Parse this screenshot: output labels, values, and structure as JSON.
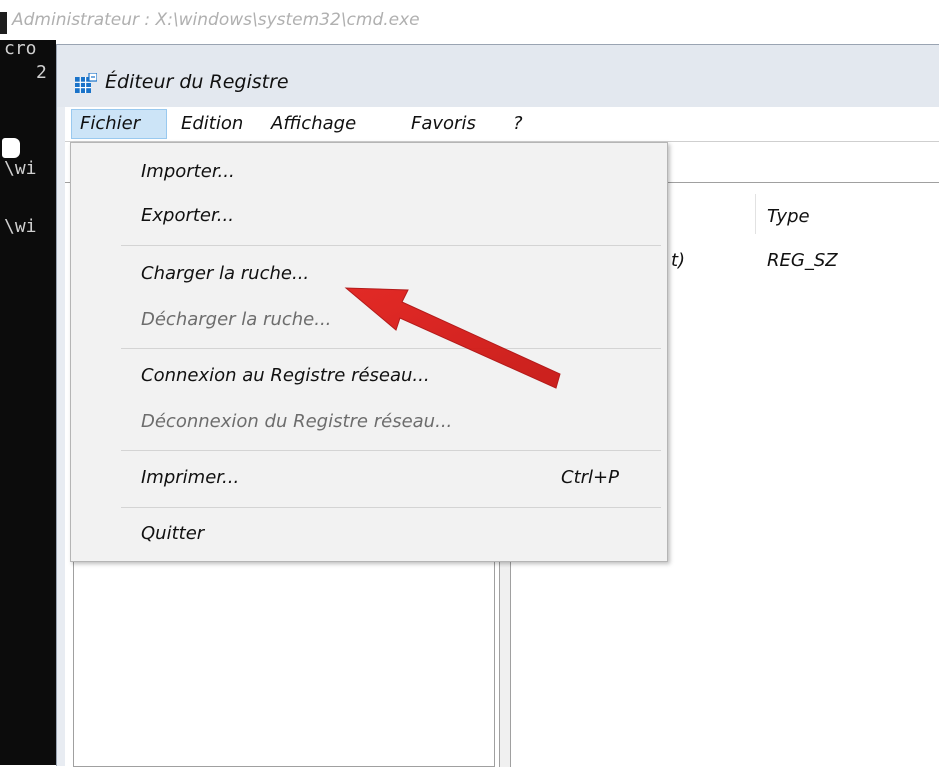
{
  "cmd": {
    "title": "Administrateur : X:\\windows\\system32\\cmd.exe",
    "lines": [
      "cro",
      "2",
      "\\wi",
      "\\wi"
    ]
  },
  "regedit": {
    "title": "Éditeur du Registre",
    "menu": [
      "Fichier",
      "Edition",
      "Affichage",
      "Favoris",
      "?"
    ],
    "list": {
      "col_type": "Type",
      "row_partial_name": "t)",
      "row_type": "REG_SZ"
    }
  },
  "file_menu": {
    "items": [
      {
        "label": "Importer...",
        "enabled": true
      },
      {
        "label": "Exporter...",
        "enabled": true
      },
      {
        "label": "Charger la ruche...",
        "enabled": true
      },
      {
        "label": "Décharger la ruche...",
        "enabled": false
      },
      {
        "label": "Connexion au Registre réseau...",
        "enabled": true
      },
      {
        "label": "Déconnexion du Registre réseau...",
        "enabled": false
      },
      {
        "label": "Imprimer...",
        "enabled": true,
        "shortcut": "Ctrl+P"
      },
      {
        "label": "Quitter",
        "enabled": true
      }
    ]
  },
  "colors": {
    "arrow": "#e2201c",
    "menu_highlight": "#cce4f7",
    "cmd_background": "#0c0c0c"
  },
  "icons": [
    "regedit-app-icon",
    "red-arrow-annotation"
  ]
}
